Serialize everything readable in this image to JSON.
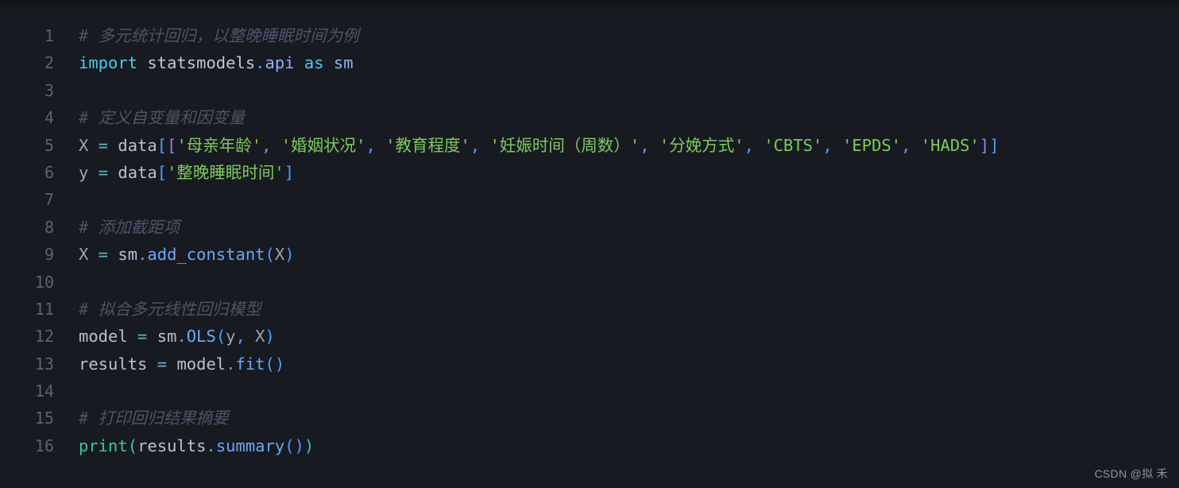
{
  "editor": {
    "background_color": "#181a21",
    "top_strip_color": "#13151b",
    "language": "python",
    "gutter_color": "#5a6273"
  },
  "colors": {
    "comment": "#4b5468",
    "keyword": "#4ec9ec",
    "string": "#7ec95f",
    "function": "#6aa9f4",
    "print": "#3fc99a",
    "bracket_blue": "#4f9dff",
    "bracket_purple": "#9a7fe0",
    "identifier": "#b9c0d2",
    "operator": "#57b6c2"
  },
  "lines": [
    {
      "number": "1",
      "text": "# 多元统计回归，以整晚睡眠时间为例"
    },
    {
      "number": "2",
      "text": "import statsmodels.api as sm"
    },
    {
      "number": "3",
      "text": ""
    },
    {
      "number": "4",
      "text": "# 定义自变量和因变量"
    },
    {
      "number": "5",
      "text": "X = data[['母亲年龄', '婚姻状况', '教育程度', '妊娠时间（周数）', '分娩方式', 'CBTS', 'EPDS', 'HADS']]"
    },
    {
      "number": "6",
      "text": "y = data['整晚睡眠时间']"
    },
    {
      "number": "7",
      "text": ""
    },
    {
      "number": "8",
      "text": "# 添加截距项"
    },
    {
      "number": "9",
      "text": "X = sm.add_constant(X)"
    },
    {
      "number": "10",
      "text": ""
    },
    {
      "number": "11",
      "text": "# 拟合多元线性回归模型"
    },
    {
      "number": "12",
      "text": "model = sm.OLS(y, X)"
    },
    {
      "number": "13",
      "text": "results = model.fit()"
    },
    {
      "number": "14",
      "text": ""
    },
    {
      "number": "15",
      "text": "# 打印回归结果摘要"
    },
    {
      "number": "16",
      "text": "print(results.summary())"
    }
  ],
  "tokens": {
    "l1_comment": "# 多元统计回归，以整晚睡眠时间为例",
    "l2_import": "import",
    "l2_module": " statsmodels",
    "l2_dot": ".",
    "l2_api": "api",
    "l2_as": " as ",
    "l2_sm": "sm",
    "l4_comment": "# 定义自变量和因变量",
    "l5_x": "X",
    "l5_eq": " = ",
    "l5_data": "data",
    "l5_br1": "[",
    "l5_br2": "[",
    "l5_s1": "'母亲年龄'",
    "l5_c1": ",",
    "l5_s2": "'婚姻状况'",
    "l5_c2": ",",
    "l5_s3": "'教育程度'",
    "l5_c3": ",",
    "l5_s4": "'妊娠时间（周数）'",
    "l5_c4": ",",
    "l5_s5": "'分娩方式'",
    "l5_c5": ",",
    "l5_s6": "'CBTS'",
    "l5_c6": ",",
    "l5_s7": "'EPDS'",
    "l5_c7": ",",
    "l5_s8": "'HADS'",
    "l5_br3": "]",
    "l5_br4": "]",
    "l6_y": "y",
    "l6_eq": " = ",
    "l6_data": "data",
    "l6_br1": "[",
    "l6_s1": "'整晚睡眠时间'",
    "l6_br2": "]",
    "l8_comment": "# 添加截距项",
    "l9_x": "X",
    "l9_eq": " = ",
    "l9_sm": "sm",
    "l9_dot": ".",
    "l9_func": "add_constant",
    "l9_p1": "(",
    "l9_arg": "X",
    "l9_p2": ")",
    "l11_comment": "# 拟合多元线性回归模型",
    "l12_model": "model",
    "l12_eq": " = ",
    "l12_sm": "sm",
    "l12_dot": ".",
    "l12_func": "OLS",
    "l12_p1": "(",
    "l12_y": "y",
    "l12_comma": ",",
    "l12_x": " X",
    "l12_p2": ")",
    "l13_results": "results",
    "l13_eq": " = ",
    "l13_model": "model",
    "l13_dot": ".",
    "l13_func": "fit",
    "l13_p1": "(",
    "l13_p2": ")",
    "l15_comment": "# 打印回归结果摘要",
    "l16_print": "print",
    "l16_p1": "(",
    "l16_results": "results",
    "l16_dot": ".",
    "l16_func": "summary",
    "l16_p2": "(",
    "l16_p3": ")",
    "l16_p4": ")"
  },
  "watermark": {
    "text": "CSDN @拟 禾"
  }
}
